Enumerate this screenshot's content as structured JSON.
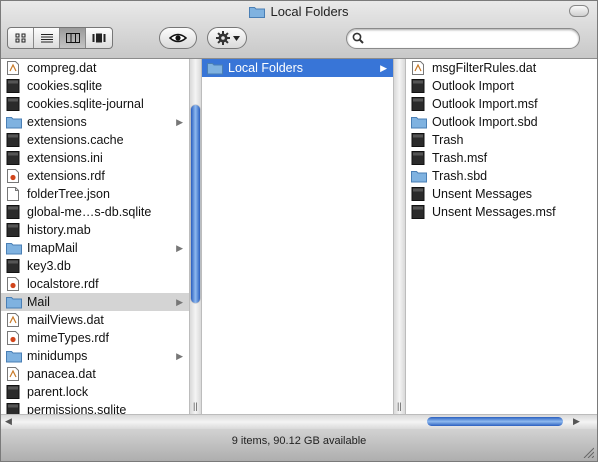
{
  "window": {
    "title": "Local Folders",
    "status_text": "9 items, 90.12 GB available"
  },
  "toolbar": {
    "view_modes": [
      "icon-view",
      "list-view",
      "column-view",
      "coverflow-view"
    ],
    "active_view": "column-view",
    "quicklook_icon": "eye-icon",
    "action_icon": "gear-icon",
    "search": {
      "value": "",
      "placeholder": ""
    }
  },
  "columns": [
    {
      "items": [
        {
          "label": "compreg.dat",
          "icon": "doc"
        },
        {
          "label": "cookies.sqlite",
          "icon": "black"
        },
        {
          "label": "cookies.sqlite-journal",
          "icon": "black"
        },
        {
          "label": "extensions",
          "icon": "folder",
          "arrow": true
        },
        {
          "label": "extensions.cache",
          "icon": "black"
        },
        {
          "label": "extensions.ini",
          "icon": "black"
        },
        {
          "label": "extensions.rdf",
          "icon": "rdf"
        },
        {
          "label": "folderTree.json",
          "icon": "white"
        },
        {
          "label": "global-me…s-db.sqlite",
          "icon": "black"
        },
        {
          "label": "history.mab",
          "icon": "black"
        },
        {
          "label": "ImapMail",
          "icon": "folder",
          "arrow": true
        },
        {
          "label": "key3.db",
          "icon": "black"
        },
        {
          "label": "localstore.rdf",
          "icon": "rdf"
        },
        {
          "label": "Mail",
          "icon": "folder",
          "arrow": true,
          "selected": "gray"
        },
        {
          "label": "mailViews.dat",
          "icon": "doc"
        },
        {
          "label": "mimeTypes.rdf",
          "icon": "rdf"
        },
        {
          "label": "minidumps",
          "icon": "folder",
          "arrow": true
        },
        {
          "label": "panacea.dat",
          "icon": "doc"
        },
        {
          "label": "parent.lock",
          "icon": "black"
        },
        {
          "label": "permissions.sqlite",
          "icon": "black"
        }
      ]
    },
    {
      "items": [
        {
          "label": "Local Folders",
          "icon": "folder",
          "arrow": true,
          "selected": "blue"
        }
      ]
    },
    {
      "items": [
        {
          "label": "msgFilterRules.dat",
          "icon": "doc"
        },
        {
          "label": "Outlook Import",
          "icon": "black"
        },
        {
          "label": "Outlook Import.msf",
          "icon": "black"
        },
        {
          "label": "Outlook Import.sbd",
          "icon": "folder"
        },
        {
          "label": "Trash",
          "icon": "black"
        },
        {
          "label": "Trash.msf",
          "icon": "black"
        },
        {
          "label": "Trash.sbd",
          "icon": "folder"
        },
        {
          "label": "Unsent Messages",
          "icon": "black"
        },
        {
          "label": "Unsent Messages.msf",
          "icon": "black"
        }
      ]
    }
  ],
  "colors": {
    "selection_blue": "#3875d7",
    "selection_gray": "#d4d4d4",
    "folder_blue": "#7fb2e0"
  }
}
